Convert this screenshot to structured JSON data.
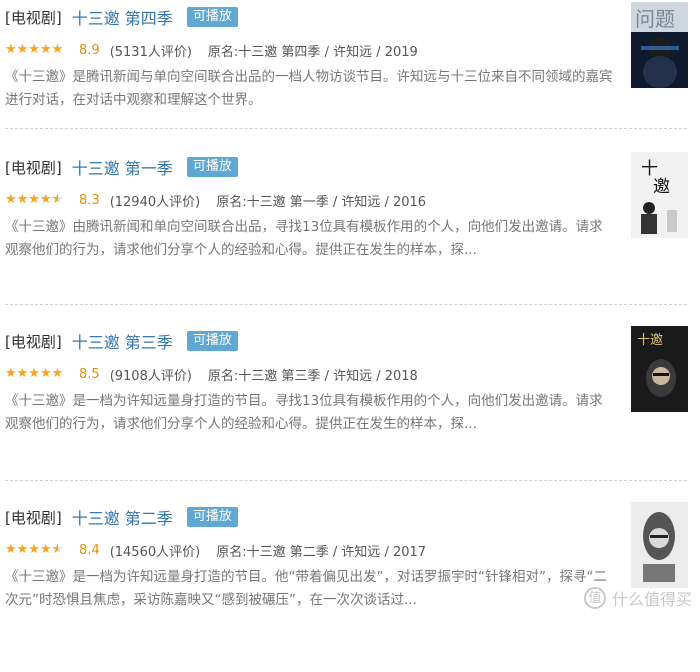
{
  "colors": {
    "link": "#3377aa",
    "badge": "#5fa8d3",
    "star": "#f5a623",
    "score": "#e09015"
  },
  "items": [
    {
      "category": "[电视剧]",
      "title": "十三邀 第四季",
      "badge": "可播放",
      "stars": 4.5,
      "score": "8.9",
      "votes": "(5131人评价)",
      "meta": "原名:十三邀 第四季 / 许知远 / 2019",
      "desc": "《十三邀》是腾讯新闻与单向空间联合出品的一档人物访谈节目。许知远与十三位来自不同领域的嘉宾进行对话，在对话中观察和理解这个世界。",
      "poster_icon": "poster-season4-icon"
    },
    {
      "category": "[电视剧]",
      "title": "十三邀 第一季",
      "badge": "可播放",
      "stars": 4,
      "score": "8.3",
      "votes": "(12940人评价)",
      "meta": "原名:十三邀 第一季 / 许知远 / 2016",
      "desc": "《十三邀》由腾讯新闻和单向空间联合出品，寻找13位具有模板作用的个人，向他们发出邀请。请求观察他们的行为，请求他们分享个人的经验和心得。提供正在发生的样本，探...",
      "poster_icon": "poster-season1-icon"
    },
    {
      "category": "[电视剧]",
      "title": "十三邀 第三季",
      "badge": "可播放",
      "stars": 4.5,
      "score": "8.5",
      "votes": "(9108人评价)",
      "meta": "原名:十三邀 第三季 / 许知远 / 2018",
      "desc": "《十三邀》是一档为许知远量身打造的节目。寻找13位具有模板作用的个人，向他们发出邀请。请求观察他们的行为，请求他们分享个人的经验和心得。提供正在发生的样本，探...",
      "poster_icon": "poster-season3-icon"
    },
    {
      "category": "[电视剧]",
      "title": "十三邀 第二季",
      "badge": "可播放",
      "stars": 4,
      "score": "8.4",
      "votes": "(14560人评价)",
      "meta": "原名:十三邀 第二季 / 许知远 / 2017",
      "desc": "《十三邀》是一档为许知远量身打造的节目。他“带着偏见出发”，对话罗振宇时“针锋相对”，探寻“二次元”时恐惧且焦虑，采访陈嘉映又“感到被碾压”，在一次次谈话过...",
      "poster_icon": "poster-season2-icon"
    }
  ],
  "watermark": {
    "icon": "zhi-icon",
    "text": "什么值得买"
  }
}
